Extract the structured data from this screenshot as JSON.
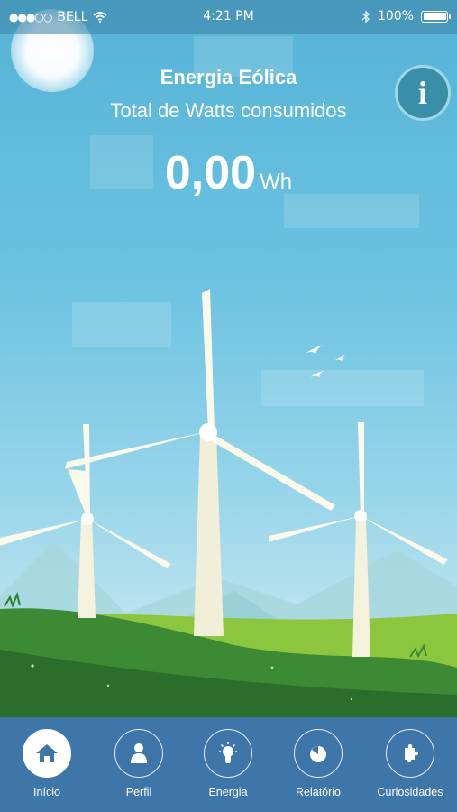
{
  "status_bar": {
    "signal_dots": "●●●○○",
    "carrier": "BELL",
    "wifi_icon": "wifi-icon",
    "time": "4:21 PM",
    "bluetooth_icon": "bluetooth-icon",
    "battery": "100%"
  },
  "header": {
    "title": "Energia Eólica",
    "subtitle": "Total de Watts consumidos",
    "value": "0,00",
    "unit": "Wh"
  },
  "info_button": {
    "icon": "info-icon",
    "label": "i"
  },
  "tabs": [
    {
      "label": "Início",
      "icon": "home-icon",
      "active": true
    },
    {
      "label": "Perfil",
      "icon": "user-icon",
      "active": false
    },
    {
      "label": "Energia",
      "icon": "lightbulb-icon",
      "active": false
    },
    {
      "label": "Relatório",
      "icon": "pie-chart-icon",
      "active": false
    },
    {
      "label": "Curiosidades",
      "icon": "puzzle-icon",
      "active": false
    }
  ],
  "colors": {
    "sky": "#55b3d6",
    "tab_bar": "#3f76a9",
    "grass_dark": "#2f7a2f",
    "grass_light": "#8cc63e"
  }
}
